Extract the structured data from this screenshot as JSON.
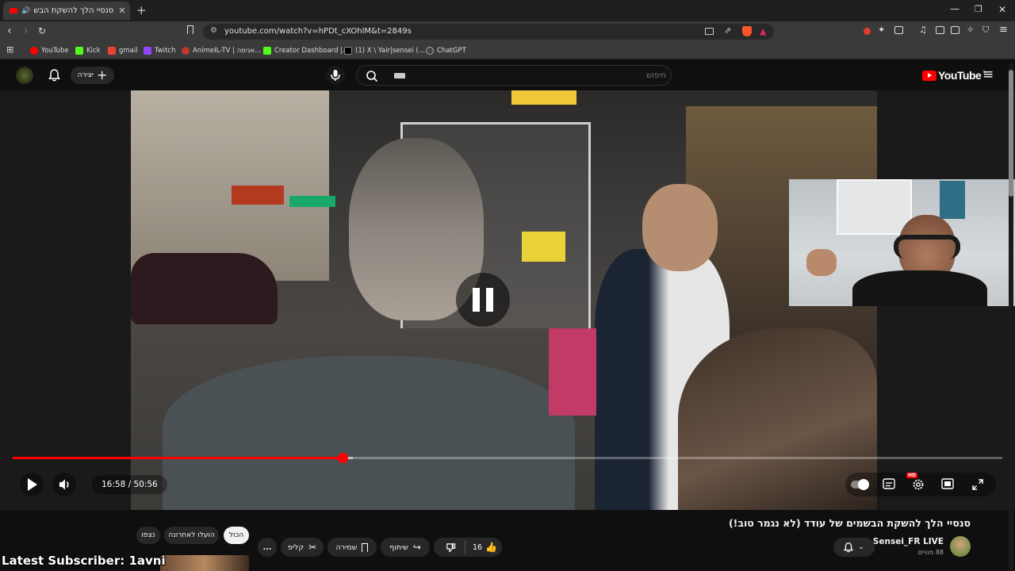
{
  "browser": {
    "tab_title": "סנסיי הלך להשקת הבשמים ש...",
    "new_tab": "+",
    "url": "youtube.com/watch?v=hPDt_cXOhlM&t=2849s",
    "bookmarks": [
      {
        "label": "YouTube",
        "color": "#ff0000"
      },
      {
        "label": "Kick",
        "color": "#53fc18"
      },
      {
        "label": "gmail",
        "color": "#ea4335"
      },
      {
        "label": "Twitch",
        "color": "#9146ff"
      },
      {
        "label": "AnimeIL-TV | אנימה...",
        "color": "#c0392b"
      },
      {
        "label": "Creator Dashboard |...",
        "color": "#53fc18"
      },
      {
        "label": "(1) X \\ Yair|sensei (...",
        "color": "#000000"
      },
      {
        "label": "ChatGPT",
        "color": "#444444"
      }
    ]
  },
  "youtube": {
    "logo": "YouTube",
    "logo_sup": "IL",
    "create_label": "יצירה",
    "search_placeholder": "חיפוש",
    "brand_color": "#ff0000"
  },
  "player": {
    "time": "16:58 / 50:56",
    "progress": 0.333,
    "hd_badge": "HD"
  },
  "video_info": {
    "title": "סנסיי הלך להשקת הבשמים של עודד (לא נגמר טוב!)",
    "channel": "Sensei_FR LIVE",
    "subscribers": "88 מנויים",
    "likes": "16",
    "share": "שיתוף",
    "save": "שמירה",
    "clip": "קליפ",
    "more": "..."
  },
  "filter_chips": [
    "הכול",
    "הועלו לאחרונה",
    "נצפו"
  ],
  "overlay": {
    "text": "Latest Subscriber: 1avni"
  }
}
